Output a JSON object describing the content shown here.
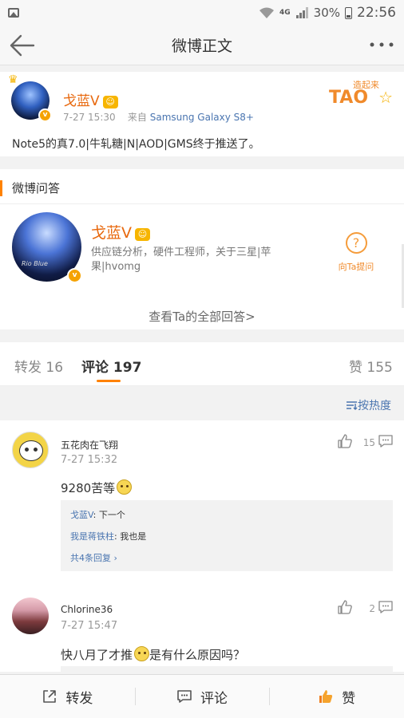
{
  "status_bar": {
    "network": "4G",
    "battery": "30%",
    "time": "22:56"
  },
  "nav": {
    "title": "微博正文"
  },
  "post": {
    "author": "戈蓝V",
    "time": "7-27 15:30",
    "source_prefix": "来自",
    "device": "Samsung Galaxy S8+",
    "text": "Note5的真7.0|牛轧糖|N|AOD|GMS终于推送了。",
    "badge_text": "TAO",
    "badge_sub": "造起来"
  },
  "qa": {
    "header": "微博问答",
    "name": "戈蓝V",
    "description": "供应链分析，硬件工程师，关于三星|苹果|hvomg",
    "avatar_caption": "Rio Blue",
    "ask_label": "向Ta提问",
    "view_all": "查看Ta的全部回答>"
  },
  "tabs": {
    "repost_label": "转发",
    "repost_count": "16",
    "comment_label": "评论",
    "comment_count": "197",
    "like_label": "赞",
    "like_count": "155"
  },
  "sort": {
    "label": "按热度"
  },
  "comments": [
    {
      "name": "五花肉在飞翔",
      "time": "7-27 15:32",
      "likes": "15",
      "text": "9280苦等",
      "replies": [
        {
          "user": "戈蓝V",
          "text": ": 下一个"
        },
        {
          "user": "我是蒋铁柱",
          "text": ": 我也是"
        }
      ],
      "more_replies": "共4条回复 ›"
    },
    {
      "name": "Chlorine36",
      "time": "7-27 15:47",
      "likes": "2",
      "text_before": "快八月了才推",
      "text_after": "是有什么原因吗？"
    }
  ],
  "bottom_bar": {
    "repost": "转发",
    "comment": "评论",
    "like": "赞"
  },
  "colors": {
    "accent": "#ff8200",
    "link": "#4a75b0",
    "name": "#e8690f"
  }
}
